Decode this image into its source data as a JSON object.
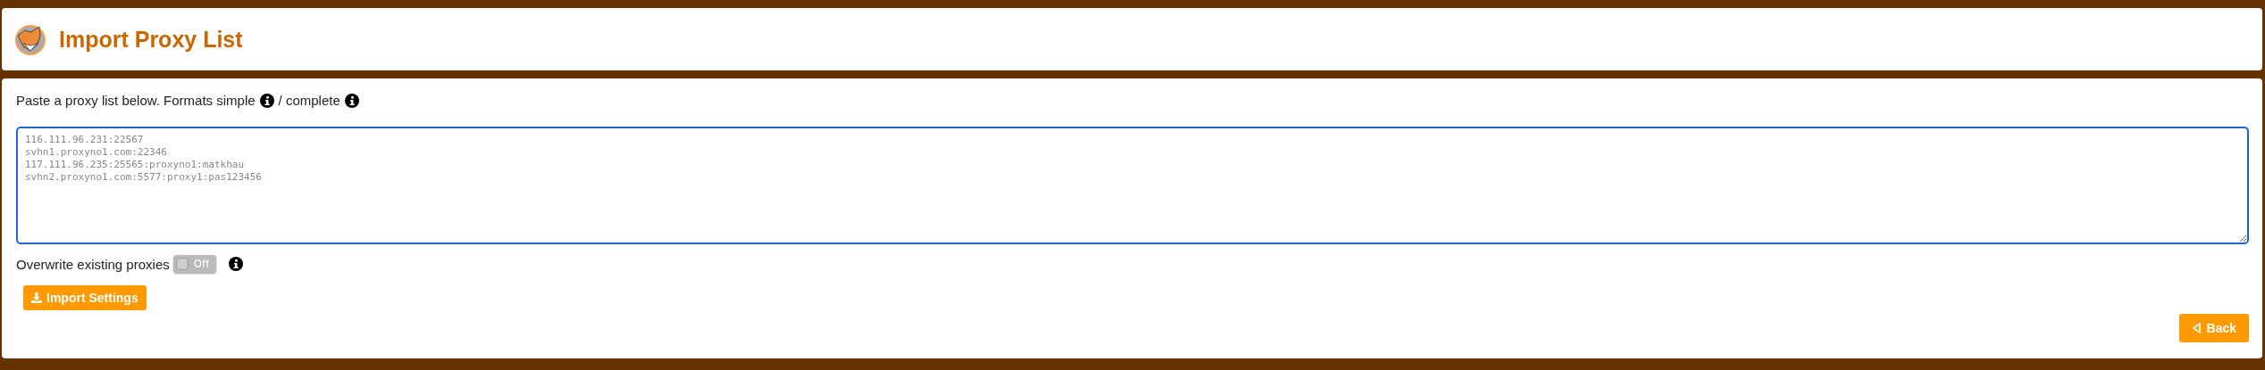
{
  "header": {
    "title": "Import Proxy List"
  },
  "intro": {
    "text": "Paste a proxy list below. Formats simple",
    "separator": "/ complete"
  },
  "proxy_list": {
    "lines": [
      "116.111.96.231:22567",
      "svhn1.proxyno1.com:22346",
      "117.111.96.235:25565:proxyno1:matkhau",
      "svhn2.proxyno1.com:5577:proxy1:pas123456"
    ]
  },
  "overwrite": {
    "label": "Overwrite existing proxies",
    "toggle_text": "Off",
    "on": false
  },
  "buttons": {
    "import": "Import Settings",
    "back": "Back"
  }
}
